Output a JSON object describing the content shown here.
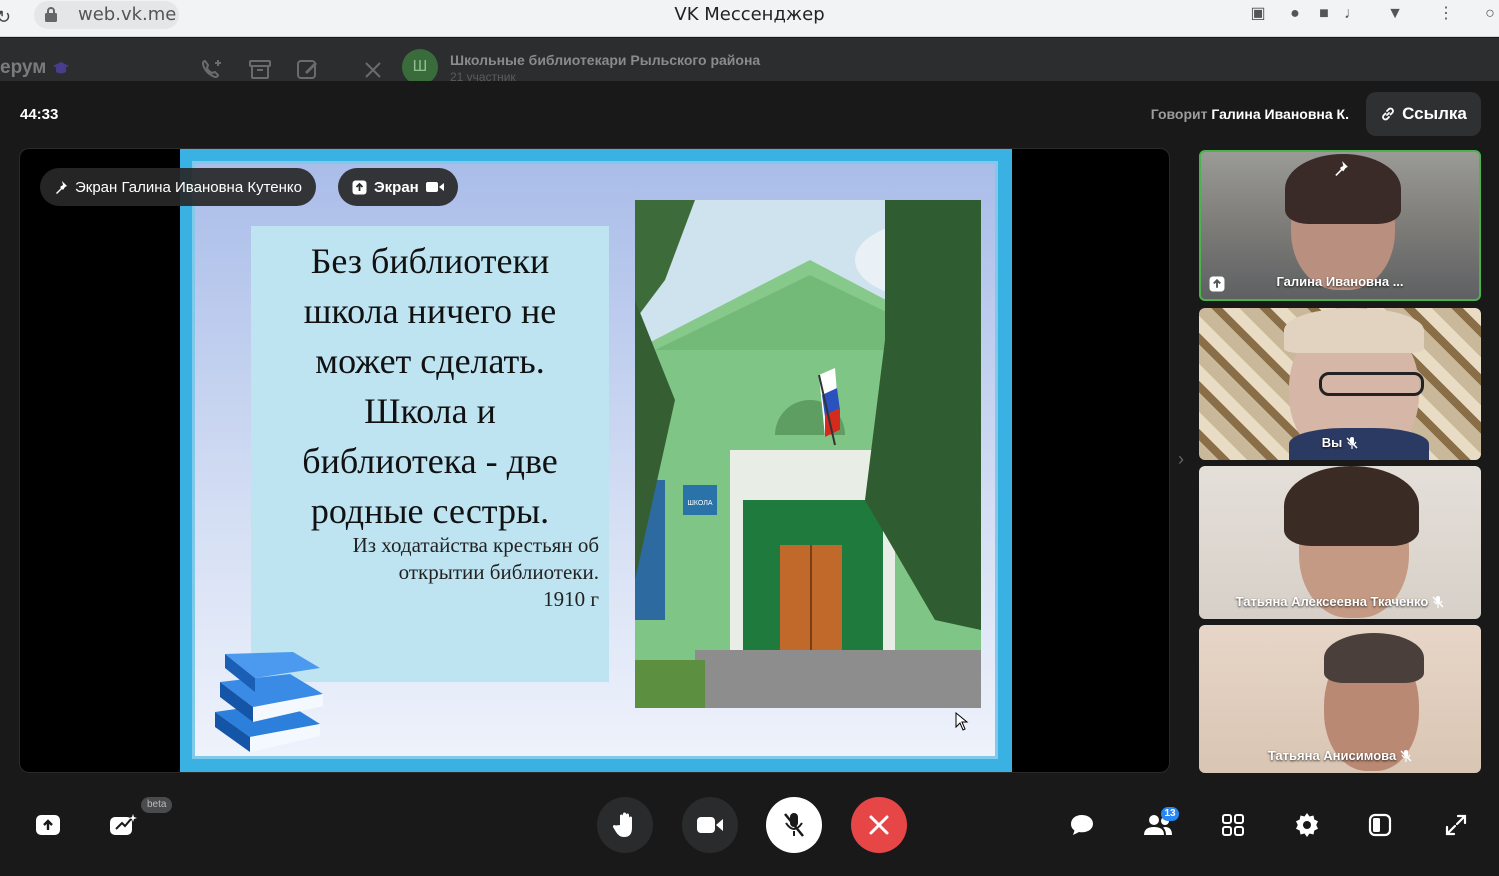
{
  "browser": {
    "url": "web.vk.me",
    "tab_title": "VK Мессенджер"
  },
  "messenger": {
    "left_title": "ерум",
    "chat_avatar_letter": "Ш",
    "chat_title": "Школьные библиотекари Рыльского района",
    "chat_subtitle": "21 участник"
  },
  "call": {
    "timer": "44:33",
    "speaker_prefix": "Говорит",
    "speaker_name": "Галина Ивановна К.",
    "link_label": "Ссылка"
  },
  "stage": {
    "screen_owner_label": "Экран Галина Ивановна Кутенко",
    "screen_label": "Экран",
    "slide": {
      "quote_lines": [
        "Без библиотеки",
        "школа ничего не",
        "может сделать.",
        "Школа и",
        "библиотека - две",
        "родные сестры."
      ],
      "source_lines": [
        "Из ходатайства крестьян об",
        "открытии библиотеки.",
        "1910 г"
      ],
      "sign_text": "ШКОЛА"
    }
  },
  "participants": [
    {
      "name": "Галина Ивановна ...",
      "muted": false,
      "sharing": true,
      "pinned": true
    },
    {
      "name": "Вы",
      "muted": true
    },
    {
      "name": "Татьяна Алексеевна Ткаченко",
      "muted": true
    },
    {
      "name": "Татьяна Анисимова",
      "muted": true
    }
  ],
  "toolbar": {
    "beta_label": "beta",
    "participants_count": "13"
  },
  "colors": {
    "end_call": "#e64646",
    "active_tile_border": "#4bb34b",
    "badge": "#2787f5"
  }
}
